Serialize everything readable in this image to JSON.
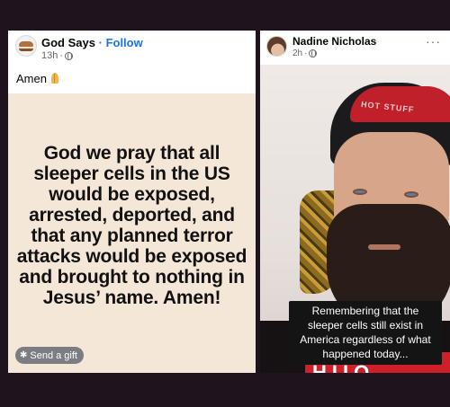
{
  "left_post": {
    "page_name": "God Says",
    "separator": "·",
    "follow_label": "Follow",
    "time": "13h",
    "caption": "Amen",
    "caption_icon": "folded-hands-icon",
    "image_text": "God we pray that all sleeper cells in the US would be exposed, arrested, deported, and that any planned terror attacks would be exposed and brought to nothing in Jesus’ name. Amen!",
    "gift_label": "Send a gift",
    "image_bg_color": "#f5e7d8"
  },
  "right_post": {
    "author_name": "Nadine Nicholas",
    "time": "2h",
    "more_label": "···",
    "video_subtitle": "Remembering that the sleeper cells still exist in America regardless of what happened today...",
    "beanie_text": "HOT STUFF",
    "shirt_text": "HIIO"
  },
  "colors": {
    "page_bg": "#1f131d",
    "link_blue": "#1b74e4",
    "meta_gray": "#65676b"
  }
}
